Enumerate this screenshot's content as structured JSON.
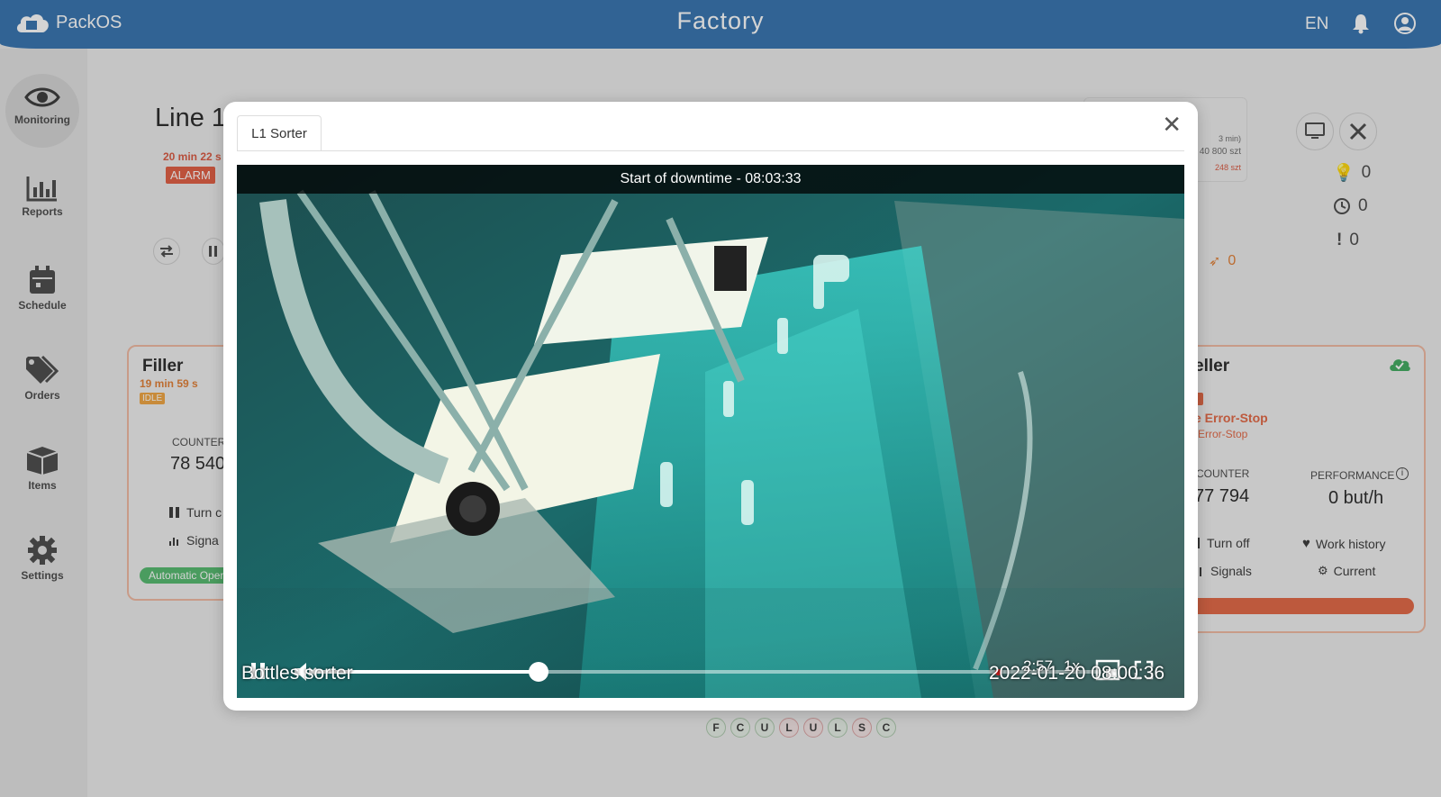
{
  "header": {
    "brand": "PackOS",
    "title": "Factory",
    "language": "EN"
  },
  "sidebar": {
    "items": [
      {
        "label": "Monitoring",
        "icon": "eye-icon",
        "active": true
      },
      {
        "label": "Reports",
        "icon": "bar-chart-icon"
      },
      {
        "label": "Schedule",
        "icon": "calendar-icon"
      },
      {
        "label": "Orders",
        "icon": "tag-icon"
      },
      {
        "label": "Items",
        "icon": "box-icon"
      },
      {
        "label": "Settings",
        "icon": "gear-icon"
      }
    ]
  },
  "line": {
    "title": "Line 1",
    "time": "20 min 22 s",
    "status": "ALARM"
  },
  "stats_box": {
    "line1": "3 min)",
    "line2": "/ 40 800 szt",
    "line3": "248 szt"
  },
  "side_counts": {
    "ideas": "0",
    "clock": "0",
    "alerts": "0",
    "rocket": "0"
  },
  "card_left": {
    "title": "Filler",
    "time": "19 min 59 s",
    "badge": "IDLE",
    "counter_label": "COUNTER",
    "counter_value": "78 540",
    "turn_label": "Turn c",
    "signals_label": "Signa",
    "mode": "Automatic Oper"
  },
  "card_right": {
    "title": "eller",
    "state": "e Error-Stop",
    "state_sub": "Error-Stop",
    "counter_label": "COUNTER",
    "counter_value": "77 794",
    "performance_label": "PERFORMANCE",
    "performance_value": "0 but/h",
    "turn_label": "Turn off",
    "history_label": "Work history",
    "signals_label": "Signals",
    "current_label": "Current"
  },
  "letters": [
    "F",
    "C",
    "U",
    "L",
    "U",
    "L",
    "S",
    "C"
  ],
  "modal": {
    "tab": "L1 Sorter",
    "close": "✕",
    "video": {
      "banner": "Start of downtime -  08:03:33",
      "camera_label": "Bottles sorter",
      "timestamp": "2022-01-20 08:00:36",
      "duration": "2:57",
      "speed": "1x",
      "progress": 0.29
    }
  },
  "colors": {
    "header": "#2f6fae",
    "alarm": "#e0583c",
    "idle": "#f0a23a",
    "ok": "#4fb86a",
    "accent": "#2aa9a0"
  }
}
